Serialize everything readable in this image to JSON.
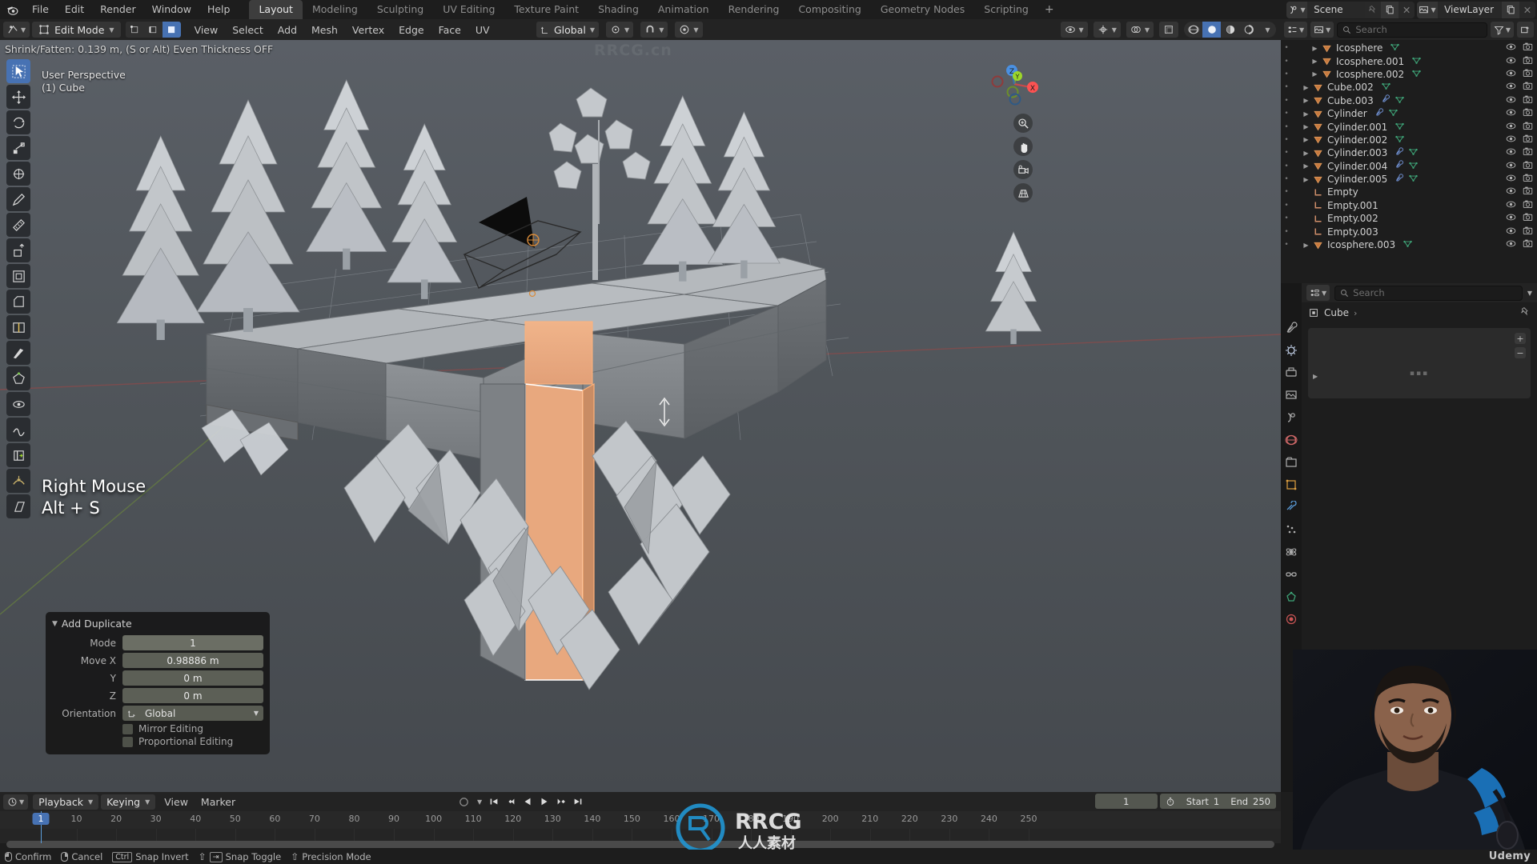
{
  "app": {
    "title": "Blender",
    "menus": [
      "File",
      "Edit",
      "Render",
      "Window",
      "Help"
    ],
    "workspaces": [
      {
        "label": "Layout",
        "active": true
      },
      {
        "label": "Modeling",
        "active": false
      },
      {
        "label": "Sculpting",
        "active": false
      },
      {
        "label": "UV Editing",
        "active": false
      },
      {
        "label": "Texture Paint",
        "active": false
      },
      {
        "label": "Shading",
        "active": false
      },
      {
        "label": "Animation",
        "active": false
      },
      {
        "label": "Rendering",
        "active": false
      },
      {
        "label": "Compositing",
        "active": false
      },
      {
        "label": "Geometry Nodes",
        "active": false
      },
      {
        "label": "Scripting",
        "active": false
      }
    ],
    "add_workspace": "+",
    "scene_name": "Scene",
    "viewlayer_name": "ViewLayer"
  },
  "viewport_header": {
    "mode": "Edit Mode",
    "select_modes": [
      "vertex-select",
      "edge-select",
      "face-select"
    ],
    "active_select_mode": "face-select",
    "menus": [
      "View",
      "Select",
      "Add",
      "Mesh",
      "Vertex",
      "Edge",
      "Face",
      "UV"
    ],
    "transform_orientation": "Global",
    "snapping": "magnet",
    "proportional": "proportional-editing"
  },
  "viewport": {
    "status_text": "Shrink/Fatten: 0.139 m, (S or Alt) Even Thickness OFF",
    "perspective_label": "User Perspective",
    "collection_label": "(1) Cube",
    "key_hint_line1": "Right Mouse",
    "key_hint_line2": "Alt + S",
    "gizmo_axes": [
      "X",
      "Y",
      "Z"
    ],
    "colors": {
      "axis_x": "#fc5252",
      "axis_y": "#9dd72a",
      "axis_z": "#4a90e2",
      "accent_blue": "#4772b3",
      "selection_orange": "#f5a06a",
      "active_white": "#ffffff"
    }
  },
  "operator_panel": {
    "title": "Add Duplicate",
    "rows": [
      {
        "label": "Mode",
        "value": "1"
      },
      {
        "label": "Move X",
        "value": "0.98886 m"
      },
      {
        "label": "Y",
        "value": "0 m"
      },
      {
        "label": "Z",
        "value": "0 m"
      }
    ],
    "orientation_label": "Orientation",
    "orientation_value": "Global",
    "checkboxes": [
      {
        "label": "Mirror Editing",
        "checked": false
      },
      {
        "label": "Proportional Editing",
        "checked": false
      }
    ]
  },
  "outliner": {
    "search_placeholder": "Search",
    "items": [
      {
        "name": "Icosphere",
        "indent": 2,
        "arrow": true,
        "icon": "mesh-triangle",
        "data_icon": true,
        "modifier": false
      },
      {
        "name": "Icosphere.001",
        "indent": 2,
        "arrow": true,
        "icon": "mesh-triangle",
        "data_icon": true,
        "modifier": false
      },
      {
        "name": "Icosphere.002",
        "indent": 2,
        "arrow": true,
        "icon": "mesh-triangle",
        "data_icon": true,
        "modifier": false
      },
      {
        "name": "Cube.002",
        "indent": 1,
        "arrow": true,
        "icon": "mesh-triangle",
        "data_icon": true,
        "modifier": false
      },
      {
        "name": "Cube.003",
        "indent": 1,
        "arrow": true,
        "icon": "mesh-triangle",
        "data_icon": true,
        "modifier": true
      },
      {
        "name": "Cylinder",
        "indent": 1,
        "arrow": true,
        "icon": "mesh-triangle",
        "data_icon": true,
        "modifier": true
      },
      {
        "name": "Cylinder.001",
        "indent": 1,
        "arrow": true,
        "icon": "mesh-triangle",
        "data_icon": true,
        "modifier": false
      },
      {
        "name": "Cylinder.002",
        "indent": 1,
        "arrow": true,
        "icon": "mesh-triangle",
        "data_icon": true,
        "modifier": false
      },
      {
        "name": "Cylinder.003",
        "indent": 1,
        "arrow": true,
        "icon": "mesh-triangle",
        "data_icon": true,
        "modifier": true
      },
      {
        "name": "Cylinder.004",
        "indent": 1,
        "arrow": true,
        "icon": "mesh-triangle",
        "data_icon": true,
        "modifier": true
      },
      {
        "name": "Cylinder.005",
        "indent": 1,
        "arrow": true,
        "icon": "mesh-triangle",
        "data_icon": true,
        "modifier": true
      },
      {
        "name": "Empty",
        "indent": 1,
        "arrow": false,
        "icon": "empty-axes",
        "data_icon": false,
        "modifier": false
      },
      {
        "name": "Empty.001",
        "indent": 1,
        "arrow": false,
        "icon": "empty-axes",
        "data_icon": false,
        "modifier": false
      },
      {
        "name": "Empty.002",
        "indent": 1,
        "arrow": false,
        "icon": "empty-axes",
        "data_icon": false,
        "modifier": false
      },
      {
        "name": "Empty.003",
        "indent": 1,
        "arrow": false,
        "icon": "empty-axes",
        "data_icon": false,
        "modifier": false
      },
      {
        "name": "Icosphere.003",
        "indent": 1,
        "arrow": true,
        "icon": "mesh-triangle",
        "data_icon": true,
        "modifier": false
      }
    ]
  },
  "properties": {
    "search_placeholder": "Search",
    "breadcrumb_object": "Cube",
    "breadcrumb_sep": "›",
    "tabs": [
      "tool-icon",
      "render-icon",
      "output-icon",
      "viewlayer-icon",
      "scene-icon",
      "world-icon",
      "collection-icon",
      "object-icon",
      "modifier-icon",
      "particles-icon",
      "physics-icon",
      "constraints-icon",
      "data-icon",
      "material-icon"
    ]
  },
  "timeline": {
    "playback_label": "Playback",
    "keying_label": "Keying",
    "view_label": "View",
    "marker_label": "Marker",
    "current_frame": "1",
    "start_label": "Start",
    "start_value": "1",
    "end_label": "End",
    "end_value": "250",
    "ticks": [
      "10",
      "20",
      "30",
      "40",
      "50",
      "60",
      "70",
      "80",
      "90",
      "100",
      "110",
      "120",
      "130",
      "140",
      "150",
      "160",
      "170",
      "180",
      "190",
      "200",
      "210",
      "220",
      "230",
      "240",
      "250"
    ],
    "playhead_frame": "1",
    "transport": [
      "jump-start-icon",
      "prev-keyframe-icon",
      "play-reverse-icon",
      "play-icon",
      "next-keyframe-icon",
      "jump-end-icon"
    ]
  },
  "statusbar": {
    "items": [
      {
        "icon": "mouse-left",
        "label": "Confirm"
      },
      {
        "icon": "mouse-right",
        "label": "Cancel"
      },
      {
        "icon": "ctrl-key",
        "label": "Snap Invert"
      },
      {
        "icon": "shift-key",
        "label": "Snap Toggle"
      },
      {
        "icon": "shift-key2",
        "label": "Precision Mode"
      }
    ],
    "brand": "Udemy"
  },
  "watermarks": {
    "center": "RRCG.cn",
    "bottom_brand": "RRCG",
    "bottom_sub": "人人素材"
  }
}
